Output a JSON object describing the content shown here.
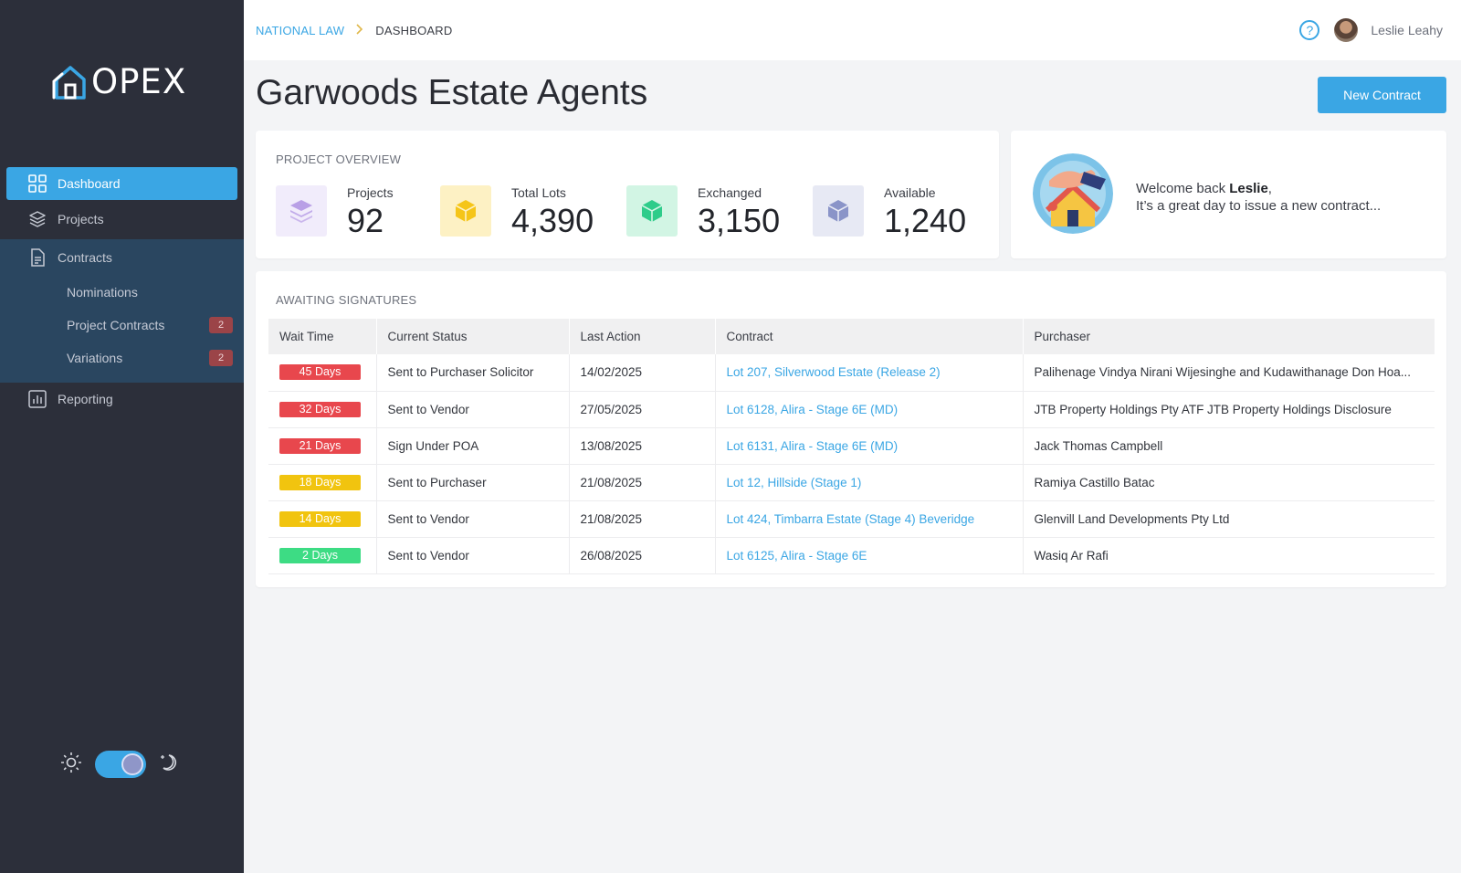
{
  "app": {
    "logo_text": "OPEX"
  },
  "sidebar": {
    "items": [
      {
        "label": "Dashboard"
      },
      {
        "label": "Projects"
      },
      {
        "label": "Contracts"
      },
      {
        "label": "Reporting"
      }
    ],
    "contracts_sub": [
      {
        "label": "Nominations",
        "badge": null
      },
      {
        "label": "Project Contracts",
        "badge": "2"
      },
      {
        "label": "Variations",
        "badge": "2"
      }
    ]
  },
  "topbar": {
    "breadcrumb": {
      "parent": "NATIONAL LAW",
      "current": "DASHBOARD"
    },
    "help_glyph": "?",
    "user_name": "Leslie Leahy"
  },
  "page": {
    "title": "Garwoods Estate Agents",
    "new_contract_label": "New Contract"
  },
  "overview": {
    "title": "PROJECT OVERVIEW",
    "stats": [
      {
        "label": "Projects",
        "value": "92",
        "icon": "layers-icon",
        "color": "#a68bd8"
      },
      {
        "label": "Total Lots",
        "value": "4,390",
        "icon": "cube-icon",
        "color": "#f5c518"
      },
      {
        "label": "Exchanged",
        "value": "3,150",
        "icon": "cube-icon",
        "color": "#2ecc8a"
      },
      {
        "label": "Available",
        "value": "1,240",
        "icon": "cube-icon",
        "color": "#8a94c8"
      }
    ]
  },
  "welcome": {
    "prefix": "Welcome back ",
    "name": "Leslie",
    "suffix": ",",
    "message": "It’s a great day to issue a new contract..."
  },
  "awaiting": {
    "title": "AWAITING SIGNATURES",
    "columns": [
      "Wait Time",
      "Current Status",
      "Last Action",
      "Contract",
      "Purchaser"
    ],
    "rows": [
      {
        "wait": "45 Days",
        "color": "#e8474d",
        "status": "Sent to Purchaser Solicitor",
        "last_action": "14/02/2025",
        "contract": "Lot 207, Silverwood Estate (Release 2)",
        "purchaser": "Palihenage Vindya Nirani Wijesinghe and Kudawithanage Don Hoa..."
      },
      {
        "wait": "32 Days",
        "color": "#e8474d",
        "status": "Sent to Vendor",
        "last_action": "27/05/2025",
        "contract": "Lot 6128, Alira - Stage 6E (MD)",
        "purchaser": "JTB Property Holdings Pty ATF JTB Property Holdings Disclosure"
      },
      {
        "wait": "21 Days",
        "color": "#e8474d",
        "status": "Sign Under POA",
        "last_action": "13/08/2025",
        "contract": "Lot 6131, Alira - Stage 6E (MD)",
        "purchaser": "Jack Thomas Campbell"
      },
      {
        "wait": "18 Days",
        "color": "#f1c40f",
        "status": "Sent to Purchaser",
        "last_action": "21/08/2025",
        "contract": "Lot 12, Hillside (Stage 1)",
        "purchaser": "Ramiya Castillo Batac"
      },
      {
        "wait": "14 Days",
        "color": "#f1c40f",
        "status": "Sent to Vendor",
        "last_action": "21/08/2025",
        "contract": "Lot 424, Timbarra Estate (Stage 4) Beveridge",
        "purchaser": "Glenvill Land Developments Pty Ltd"
      },
      {
        "wait": "2 Days",
        "color": "#3ddc84",
        "status": "Sent to Vendor",
        "last_action": "26/08/2025",
        "contract": "Lot 6125, Alira - Stage 6E",
        "purchaser": "Wasiq Ar Rafi"
      }
    ]
  },
  "theme": {
    "mode": "dark",
    "accent": "#3aa6e4"
  }
}
